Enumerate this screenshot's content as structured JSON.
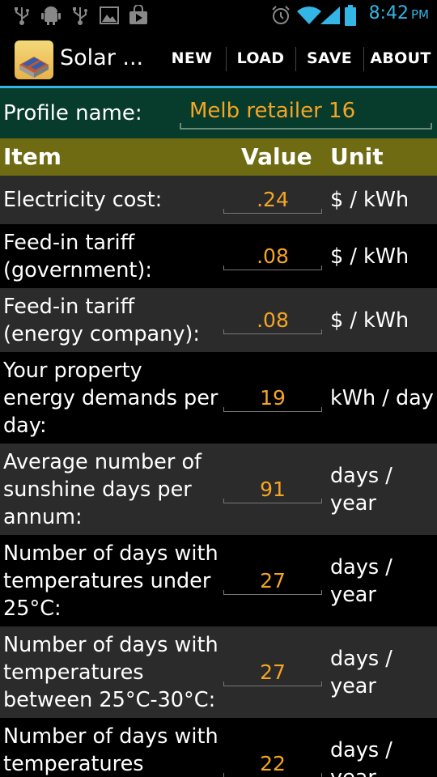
{
  "status_bar": {
    "time": "8:42",
    "ampm": "PM",
    "left_icons": [
      "usb-icon",
      "android-debug-icon",
      "usb-icon",
      "gallery-icon",
      "play-store-icon"
    ],
    "right_icons": [
      "alarm-icon",
      "wifi-icon",
      "signal-icon",
      "battery-icon"
    ],
    "accent_color": "#33b5e5"
  },
  "action_bar": {
    "title": "Solar ...",
    "buttons": [
      "NEW",
      "LOAD",
      "SAVE",
      "ABOUT"
    ]
  },
  "profile": {
    "label": "Profile name:",
    "value": "Melb retailer 16"
  },
  "table": {
    "headers": {
      "item": "Item",
      "value": "Value",
      "unit": "Unit"
    },
    "rows": [
      {
        "label": "Electricity cost:",
        "value": ".24",
        "unit": "$ / kWh"
      },
      {
        "label": "Feed-in tariff (government):",
        "value": ".08",
        "unit": "$ / kWh"
      },
      {
        "label": "Feed-in tariff (energy company):",
        "value": ".08",
        "unit": "$ / kWh"
      },
      {
        "label": "Your property energy demands per day:",
        "value": "19",
        "unit": "kWh / day"
      },
      {
        "label": "Average number of sunshine days per annum:",
        "value": "91",
        "unit": "days / year"
      },
      {
        "label": "Number of days with temperatures under 25°C:",
        "value": "27",
        "unit": "days / year"
      },
      {
        "label": "Number of days with temperatures between 25°C-30°C:",
        "value": "27",
        "unit": "days / year"
      },
      {
        "label": "Number of days with temperatures",
        "value": "22",
        "unit": "days / year"
      }
    ]
  },
  "colors": {
    "value_text": "#f5a524",
    "profile_bg": "#073b2c",
    "header_bg": "#6e6b12",
    "row_odd_bg": "#2b2b2b",
    "row_even_bg": "#000000"
  }
}
